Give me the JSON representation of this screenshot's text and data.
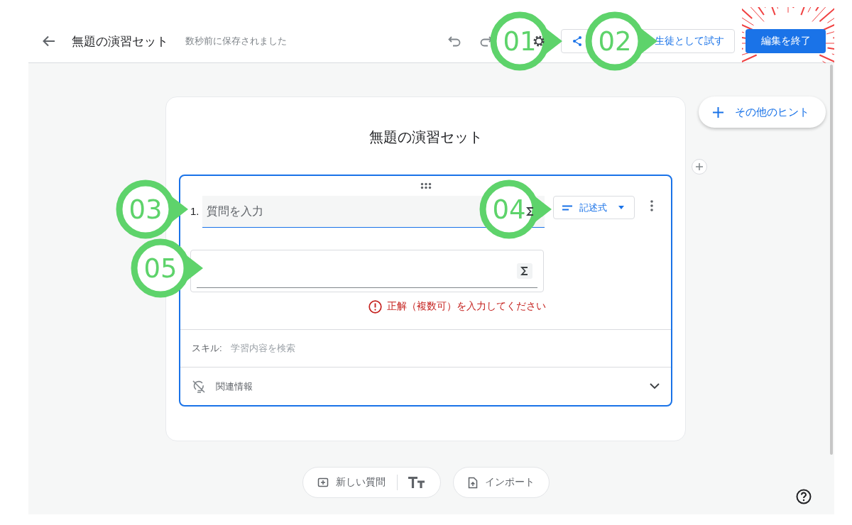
{
  "header": {
    "title": "無題の演習セット",
    "save_status": "数秒前に保存されました",
    "try_button": "生徒として試す",
    "finish_button": {
      "label": "編集を終了",
      "highlighted": true
    }
  },
  "hint_button": "その他のヒント",
  "card": {
    "title": "無題の演習セット",
    "question": {
      "number": "1.",
      "placeholder": "質問を入力",
      "type": "記述式",
      "error": "正解（複数可）を入力してください",
      "skills_label": "スキル:",
      "skills_placeholder": "学習内容を検索",
      "related_label": "関連情報",
      "expanded": false
    }
  },
  "bottom_buttons": [
    {
      "kind": "new",
      "label": "新しい質問"
    },
    {
      "kind": "import",
      "label": "インポート"
    }
  ],
  "callouts": [
    {
      "label": "01"
    },
    {
      "label": "02"
    },
    {
      "label": "03"
    },
    {
      "label": "04"
    },
    {
      "label": "05"
    }
  ]
}
